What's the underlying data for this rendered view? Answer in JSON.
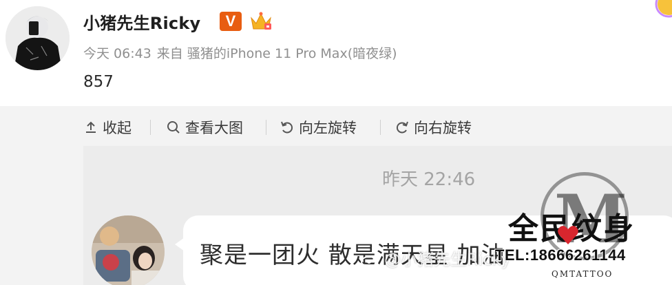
{
  "post": {
    "username": "小猪先生Ricky",
    "verified_badge": "V",
    "time": "今天 06:43",
    "source": "来自 骚猪的iPhone 11 Pro Max(暗夜绿)",
    "content": "857"
  },
  "toolbar": {
    "items": [
      {
        "label": "收起",
        "icon": "collapse-icon"
      },
      {
        "label": "查看大图",
        "icon": "search-icon"
      },
      {
        "label": "向左旋转",
        "icon": "rotate-left-icon"
      },
      {
        "label": "向右旋转",
        "icon": "rotate-right-icon"
      }
    ]
  },
  "image": {
    "timestamp": "昨天 22:46",
    "message": "聚是一团火 散是满天星 加油",
    "weibo_watermark": "@小猪先生Ricky",
    "stamp": {
      "title": "全民纹身",
      "letter": "M",
      "tel": "TEL:18666261144",
      "brand": "QMTATTOO"
    }
  },
  "colors": {
    "badge": "#e85d11",
    "meta_text": "#8f8f8f",
    "image_bg": "#ececec"
  }
}
